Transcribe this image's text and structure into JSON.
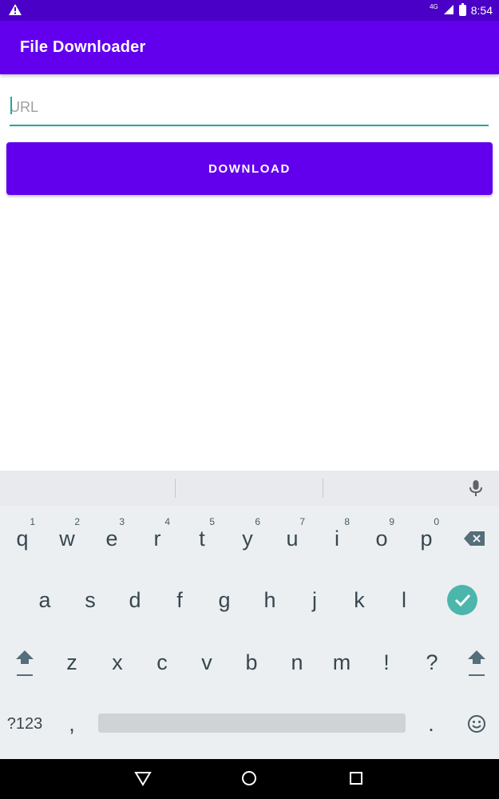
{
  "status": {
    "time": "8:54",
    "network": "4G"
  },
  "app": {
    "title": "File Downloader"
  },
  "form": {
    "url_placeholder": "URL",
    "url_value": "",
    "download_label": "DOWNLOAD"
  },
  "keyboard": {
    "row1": [
      {
        "label": "q",
        "hint": "1"
      },
      {
        "label": "w",
        "hint": "2"
      },
      {
        "label": "e",
        "hint": "3"
      },
      {
        "label": "r",
        "hint": "4"
      },
      {
        "label": "t",
        "hint": "5"
      },
      {
        "label": "y",
        "hint": "6"
      },
      {
        "label": "u",
        "hint": "7"
      },
      {
        "label": "i",
        "hint": "8"
      },
      {
        "label": "o",
        "hint": "9"
      },
      {
        "label": "p",
        "hint": "0"
      }
    ],
    "row2": [
      "a",
      "s",
      "d",
      "f",
      "g",
      "h",
      "j",
      "k",
      "l"
    ],
    "row3": [
      "z",
      "x",
      "c",
      "v",
      "b",
      "n",
      "m",
      "!",
      "?"
    ],
    "symbols_label": "?123",
    "comma": ",",
    "period": "."
  },
  "colors": {
    "primary": "#6200ee",
    "status": "#4a00c7",
    "accent": "#26a69a",
    "done": "#4db6ac"
  }
}
